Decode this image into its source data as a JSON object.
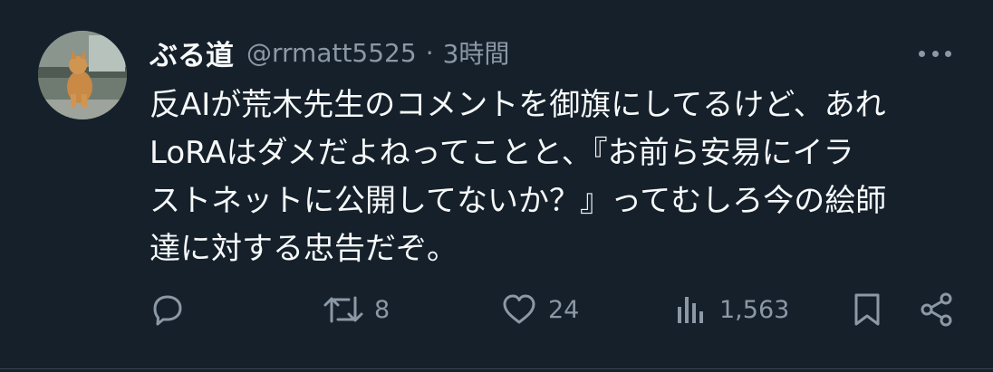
{
  "user": {
    "display_name": "ぶる道",
    "handle": "@rrmatt5525",
    "separator": "·",
    "timestamp": "3時間"
  },
  "tweet": {
    "lines": [
      "反AIが荒木先生のコメントを御旗にしてるけど、あれ",
      "LoRAはダメだよねってことと、『お前ら安易にイラ",
      "ストネットに公開してないか？』ってむしろ今の絵師",
      "達に対する忠告だぞ。"
    ]
  },
  "actions": {
    "reply_count": "",
    "retweet_count": "8",
    "like_count": "24",
    "views_count": "1,563"
  },
  "colors": {
    "background": "#15202b",
    "text": "#f7f9f9",
    "muted": "#8b98a5"
  }
}
